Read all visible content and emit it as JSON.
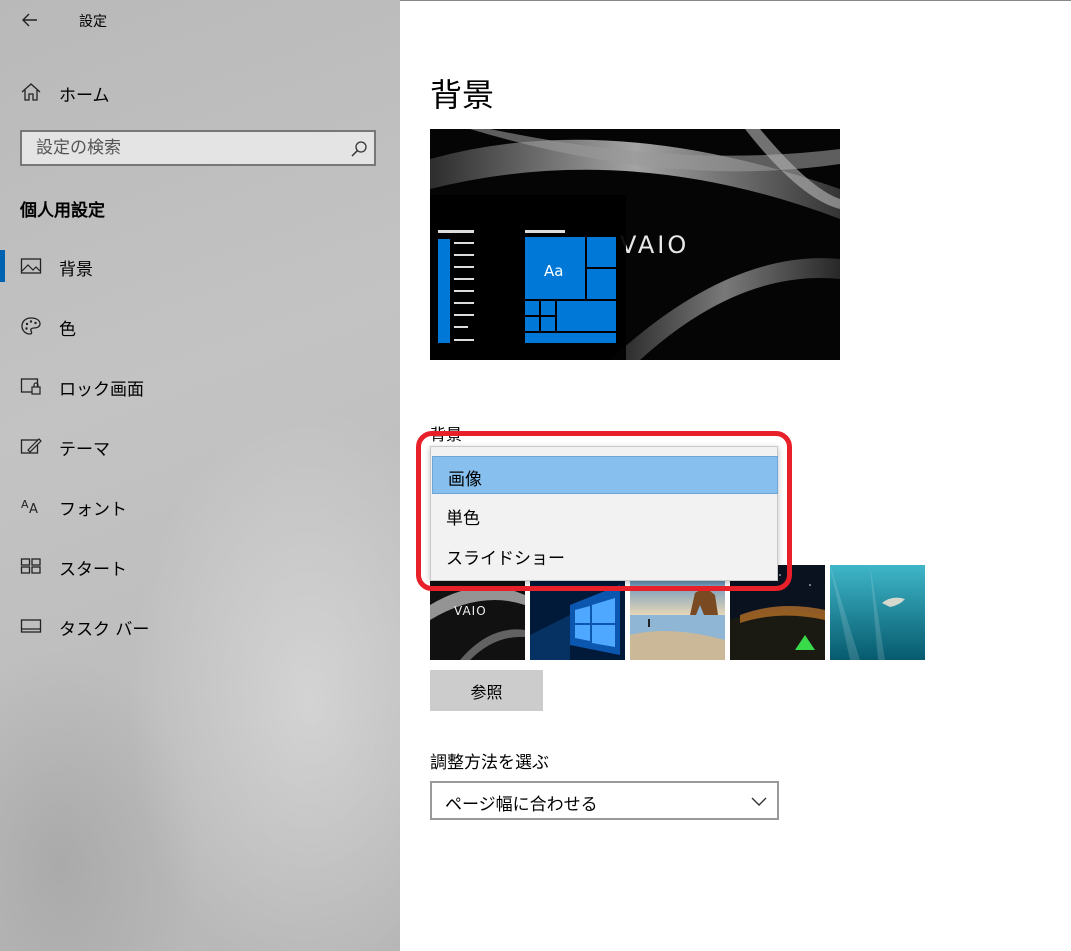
{
  "window": {
    "title": "設定"
  },
  "sidebar": {
    "home_label": "ホーム",
    "search_placeholder": "設定の検索",
    "section_title": "個人用設定",
    "items": [
      {
        "label": "背景",
        "icon": "picture-icon",
        "active": true
      },
      {
        "label": "色",
        "icon": "palette-icon",
        "active": false
      },
      {
        "label": "ロック画面",
        "icon": "lock-screen-icon",
        "active": false
      },
      {
        "label": "テーマ",
        "icon": "theme-brush-icon",
        "active": false
      },
      {
        "label": "フォント",
        "icon": "font-icon",
        "active": false
      },
      {
        "label": "スタート",
        "icon": "start-tiles-icon",
        "active": false
      },
      {
        "label": "タスク バー",
        "icon": "taskbar-icon",
        "active": false
      }
    ]
  },
  "main": {
    "title": "背景",
    "preview": {
      "logo_text": "VAIO",
      "tile_text": "Aa",
      "accent_color": "#0078d7"
    },
    "background_label": "背景",
    "background_options": [
      {
        "label": "画像",
        "selected": true
      },
      {
        "label": "単色",
        "selected": false
      },
      {
        "label": "スライドショー",
        "selected": false
      }
    ],
    "thumbnails": [
      {
        "name": "vaio-wallpaper",
        "logo_text": "VAIO"
      },
      {
        "name": "windows-hero"
      },
      {
        "name": "beach-rocks"
      },
      {
        "name": "night-tent"
      },
      {
        "name": "underwater-swimmer"
      }
    ],
    "browse_label": "参照",
    "fit_label": "調整方法を選ぶ",
    "fit_value": "ページ幅に合わせる"
  },
  "colors": {
    "highlight": "#e8202a",
    "selection": "#87c0ee",
    "accent": "#0078d7"
  }
}
